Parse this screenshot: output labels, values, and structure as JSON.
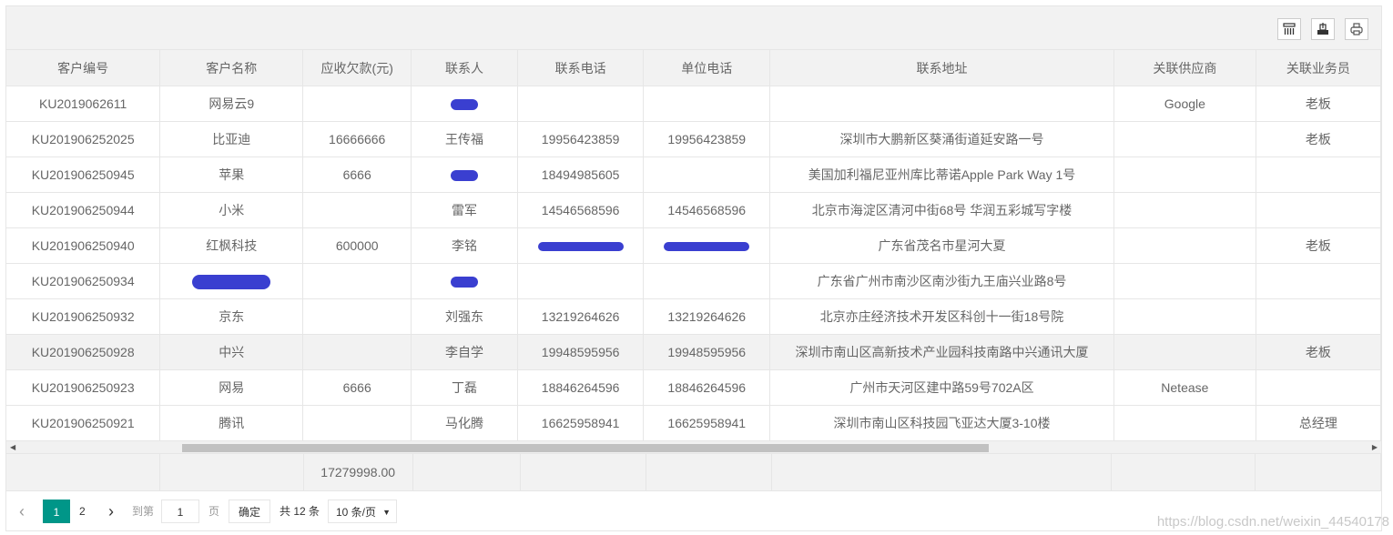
{
  "toolbar": {
    "buttons": [
      {
        "name": "columns-filter",
        "icon": "columns-icon"
      },
      {
        "name": "export",
        "icon": "export-icon"
      },
      {
        "name": "print",
        "icon": "print-icon"
      }
    ]
  },
  "table": {
    "columns": [
      "客户编号",
      "客户名称",
      "应收欠款(元)",
      "联系人",
      "联系电话",
      "单位电话",
      "联系地址",
      "关联供应商",
      "关联业务员"
    ],
    "rows": [
      {
        "id": "KU2019062611",
        "name": "网易云9",
        "debt": "",
        "contact": "[redacted]",
        "phone": "",
        "unit_phone": "",
        "address": "",
        "supplier": "Google",
        "salesman": "老板"
      },
      {
        "id": "KU201906252025",
        "name": "比亚迪",
        "debt": "16666666",
        "contact": "王传福",
        "phone": "19956423859",
        "unit_phone": "19956423859",
        "address": "深圳市大鹏新区葵涌街道延安路一号",
        "supplier": "",
        "salesman": "老板"
      },
      {
        "id": "KU201906250945",
        "name": "苹果",
        "debt": "6666",
        "contact": "[redacted]",
        "phone": "18494985605",
        "unit_phone": "",
        "address": "美国加利福尼亚州库比蒂诺Apple Park Way 1号",
        "supplier": "",
        "salesman": ""
      },
      {
        "id": "KU201906250944",
        "name": "小米",
        "debt": "",
        "contact": "雷军",
        "phone": "14546568596",
        "unit_phone": "14546568596",
        "address": "北京市海淀区清河中街68号 华润五彩城写字楼",
        "supplier": "",
        "salesman": ""
      },
      {
        "id": "KU201906250940",
        "name": "红枫科技",
        "debt": "600000",
        "contact": "李铭",
        "phone": "[redacted]",
        "unit_phone": "[redacted]",
        "address": "广东省茂名市星河大夏",
        "supplier": "",
        "salesman": "老板"
      },
      {
        "id": "KU201906250934",
        "name": "[redacted]",
        "debt": "",
        "contact": "[redacted]",
        "phone": "",
        "unit_phone": "",
        "address": "广东省广州市南沙区南沙街九王庙兴业路8号",
        "supplier": "",
        "salesman": ""
      },
      {
        "id": "KU201906250932",
        "name": "京东",
        "debt": "",
        "contact": "刘强东",
        "phone": "13219264626",
        "unit_phone": "13219264626",
        "address": "北京亦庄经济技术开发区科创十一街18号院",
        "supplier": "",
        "salesman": ""
      },
      {
        "id": "KU201906250928",
        "name": "中兴",
        "debt": "",
        "contact": "李自学",
        "phone": "19948595956",
        "unit_phone": "19948595956",
        "address": "深圳市南山区高新技术产业园科技南路中兴通讯大厦",
        "supplier": "",
        "salesman": "老板"
      },
      {
        "id": "KU201906250923",
        "name": "网易",
        "debt": "6666",
        "contact": "丁磊",
        "phone": "18846264596",
        "unit_phone": "18846264596",
        "address": "广州市天河区建中路59号702A区",
        "supplier": "Netease",
        "salesman": ""
      },
      {
        "id": "KU201906250921",
        "name": "腾讯",
        "debt": "",
        "contact": "马化腾",
        "phone": "16625958941",
        "unit_phone": "16625958941",
        "address": "深圳市南山区科技园飞亚达大厦3-10楼",
        "supplier": "",
        "salesman": "总经理"
      }
    ],
    "total_debt": "17279998.00"
  },
  "pager": {
    "prev": "‹",
    "page1": "1",
    "page2": "2",
    "next": "›",
    "goto_label": "到第",
    "goto_value": "1",
    "page_label": "页",
    "confirm_label": "确定",
    "total_label": "共 12 条",
    "page_size": "10 条/页"
  },
  "watermark": "https://blog.csdn.net/weixin_44540178"
}
